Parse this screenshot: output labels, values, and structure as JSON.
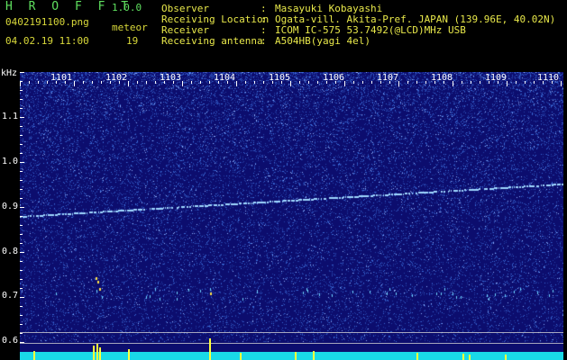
{
  "header": {
    "app_title": "H R O F F T",
    "app_version": "1.0.0",
    "filename": "0402191100.png",
    "datetime": "04.02.19 11:00",
    "meteor_label": "meteor",
    "meteor_count": "19"
  },
  "info": [
    {
      "key": "Observer",
      "sep": ":",
      "value": "Masayuki Kobayashi"
    },
    {
      "key": "Receiving Location",
      "sep": ":",
      "value": "Ogata-vill. Akita-Pref. JAPAN (139.96E, 40.02N)"
    },
    {
      "key": "Receiver",
      "sep": ":",
      "value": "ICOM IC-575 53.7492(@LCD)MHz USB"
    },
    {
      "key": "Receiving antenna",
      "sep": ":",
      "value": "A504HB(yagi 4el)"
    }
  ],
  "spectrogram": {
    "y_unit": "kHz",
    "y_ticks": [
      "1.1",
      "1.0",
      "0.9",
      "0.8",
      "0.7",
      "0.6"
    ],
    "x_ticks": [
      "1101",
      "1102",
      "1103",
      "1104",
      "1105",
      "1106",
      "1107",
      "1108",
      "1109",
      "1110"
    ],
    "colors": {
      "background": "#0c0d6e",
      "noise": "#3a6bd8",
      "trace": "#9fd7ff",
      "meteor": "#ffff3a",
      "baseline": "#19d9e8"
    }
  }
}
